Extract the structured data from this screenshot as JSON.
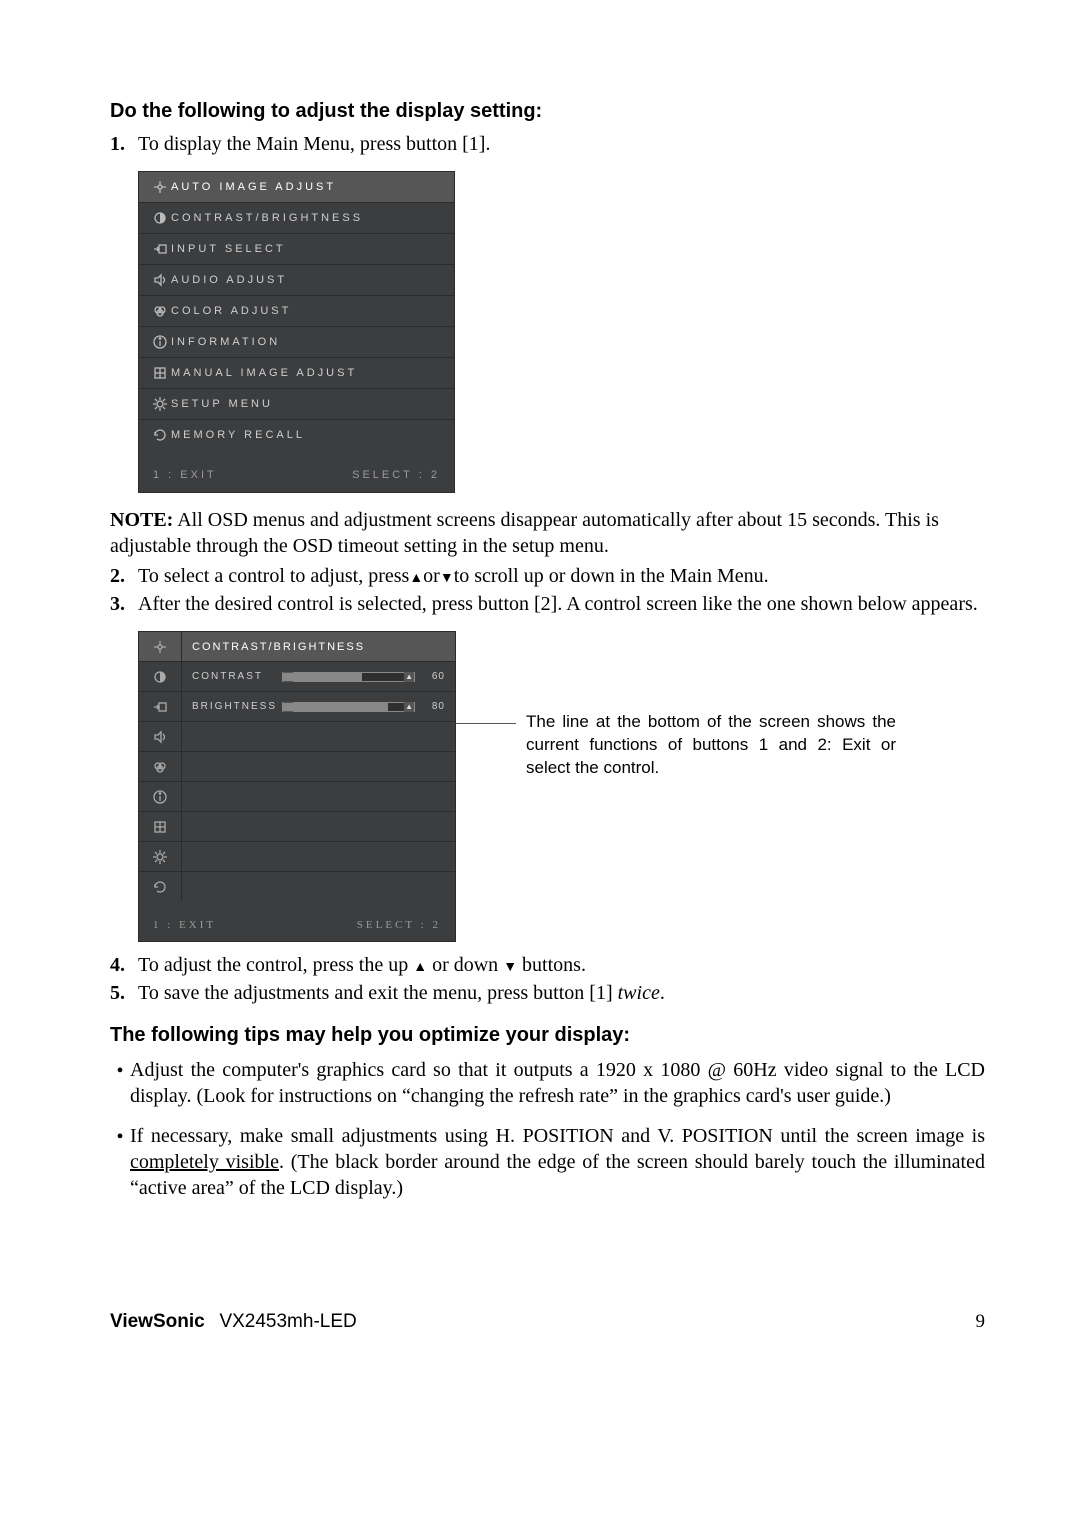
{
  "heading1": "Do the following to adjust the display setting:",
  "step1": "To display the Main Menu, press button [1].",
  "osd_main": {
    "items": [
      "AUTO IMAGE ADJUST",
      "CONTRAST/BRIGHTNESS",
      "INPUT SELECT",
      "AUDIO ADJUST",
      "COLOR ADJUST",
      "INFORMATION",
      "MANUAL IMAGE ADJUST",
      "SETUP MENU",
      "MEMORY RECALL"
    ],
    "footer_left": "1 : EXIT",
    "footer_right": "SELECT : 2"
  },
  "note_label": "NOTE:",
  "note_text": " All OSD menus and adjustment screens disappear automatically after about 15 seconds. This is adjustable through the OSD timeout setting in the setup menu.",
  "step2_a": "To select a control to adjust, press",
  "step2_b": "or",
  "step2_c": "to scroll up or down in the Main Menu.",
  "step3": "After the desired control is selected, press button [2]. A control screen like the one shown below appears.",
  "osd_sub": {
    "header": "CONTRAST/BRIGHTNESS",
    "rows": [
      {
        "label": "CONTRAST",
        "value": "60",
        "fill_pct": 60
      },
      {
        "label": "BRIGHTNESS",
        "value": "80",
        "fill_pct": 80
      }
    ],
    "footer_left": "1 : EXIT",
    "footer_right": "SELECT : 2"
  },
  "callout": "The line at the bottom of the screen shows the current functions of buttons 1 and 2: Exit or select the control.",
  "step4_a": "To adjust the control, press the up ",
  "step4_b": " or down ",
  "step4_c": " buttons.",
  "step5_a": "To save the adjustments and exit the menu, press button [1] ",
  "step5_b": "twice",
  "step5_c": ".",
  "heading2": "The following tips may help you optimize your display:",
  "tip1": "Adjust the computer's graphics card so that it outputs a 1920 x 1080 @ 60Hz video signal to the LCD display. (Look for instructions on “changing the refresh rate” in the graphics card's user guide.)",
  "tip2_a": "If necessary, make small adjustments using H. POSITION and V. POSITION until the screen image is ",
  "tip2_under": "completely visible",
  "tip2_b": ". (The black border around the edge of the screen should barely touch the illuminated “active area” of the LCD display.)",
  "footer": {
    "brand": "ViewSonic",
    "model": "VX2453mh-LED",
    "page": "9"
  }
}
